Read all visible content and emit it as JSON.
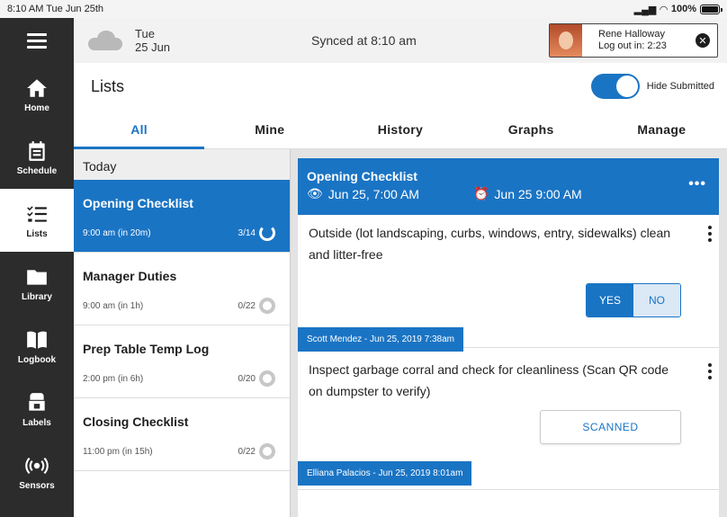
{
  "status_bar": {
    "time_date": "8:10 AM Tue Jun 25th",
    "battery": "100%"
  },
  "sidebar": {
    "items": [
      {
        "label": "Home",
        "icon": "home-icon",
        "active": false
      },
      {
        "label": "Schedule",
        "icon": "calendar-icon",
        "active": false
      },
      {
        "label": "Lists",
        "icon": "checklist-icon",
        "active": true
      },
      {
        "label": "Library",
        "icon": "folder-icon",
        "active": false
      },
      {
        "label": "Logbook",
        "icon": "book-icon",
        "active": false
      },
      {
        "label": "Labels",
        "icon": "printer-icon",
        "active": false
      },
      {
        "label": "Sensors",
        "icon": "broadcast-icon",
        "active": false
      }
    ]
  },
  "topbar": {
    "weather": {
      "day": "Tue",
      "date": "25 Jun",
      "icon": "cloud-icon"
    },
    "sync_text": "Synced at 8:10 am",
    "user": {
      "name": "Rene Halloway",
      "logout": "Log out in: 2:23"
    }
  },
  "page": {
    "title": "Lists",
    "toggle_label": "Hide Submitted",
    "toggle_on": true
  },
  "tabs": [
    {
      "label": "All",
      "active": true
    },
    {
      "label": "Mine",
      "active": false
    },
    {
      "label": "History",
      "active": false
    },
    {
      "label": "Graphs",
      "active": false
    },
    {
      "label": "Manage",
      "active": false
    }
  ],
  "list": {
    "section": "Today",
    "items": [
      {
        "name": "Opening Checklist",
        "time": "9:00 am (in 20m)",
        "count": "3/14",
        "selected": true
      },
      {
        "name": "Manager Duties",
        "time": "9:00 am (in 1h)",
        "count": "0/22",
        "selected": false
      },
      {
        "name": "Prep Table Temp Log",
        "time": "2:00 pm (in 6h)",
        "count": "0/20",
        "selected": false
      },
      {
        "name": "Closing Checklist",
        "time": "11:00 pm (in 15h)",
        "count": "0/22",
        "selected": false
      }
    ]
  },
  "detail": {
    "title": "Opening Checklist",
    "start": "Jun 25, 7:00 AM",
    "due": "Jun 25 9:00 AM",
    "tasks": [
      {
        "text": "Outside (lot landscaping, curbs, windows, entry, sidewalks) clean and litter-free",
        "yes": "YES",
        "no": "NO",
        "signature": "Scott Mendez - Jun 25, 2019 7:38am"
      },
      {
        "text": "Inspect garbage corral and check for cleanliness (Scan QR code on dumpster to verify)",
        "button": "SCANNED",
        "signature": "Elliana Palacios - Jun 25, 2019 8:01am"
      }
    ]
  },
  "colors": {
    "accent": "#1a74c4",
    "sidebar": "#2c2c2c"
  }
}
